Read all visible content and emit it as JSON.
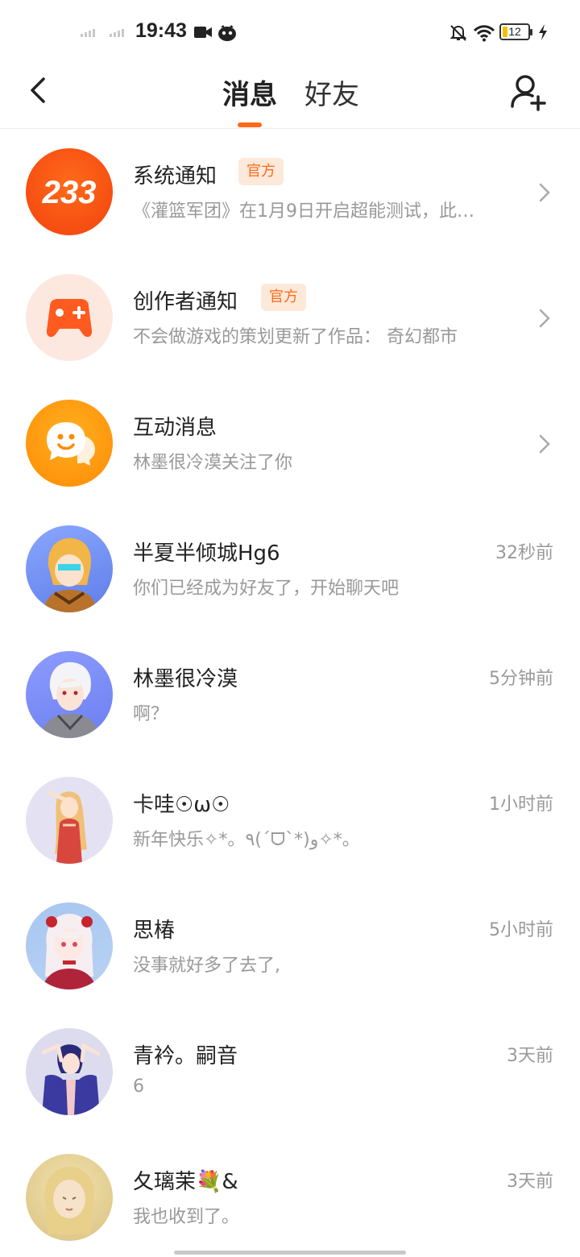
{
  "status_bar": {
    "time": "19:43",
    "battery": "12",
    "icons": [
      "video-camera-icon",
      "app-notification-icon",
      "mute-bell-icon",
      "wifi-icon",
      "battery-icon",
      "charging-bolt-icon"
    ]
  },
  "header": {
    "tabs": [
      {
        "label": "消息",
        "active": true
      },
      {
        "label": "好友",
        "active": false
      }
    ],
    "accent_color": "#ff6a1a"
  },
  "messages": [
    {
      "name": "系统通知",
      "badge": "官方",
      "preview": "《灌篮军团》在1月9日开启超能测试，此…",
      "time": "",
      "avatar": "logo-233-icon"
    },
    {
      "name": "创作者通知",
      "badge": "官方",
      "preview": "不会做游戏的策划更新了作品：  奇幻都市",
      "time": "",
      "avatar": "gamepad-icon"
    },
    {
      "name": "互动消息",
      "badge": "",
      "preview": "林墨很冷漠关注了你",
      "time": "",
      "avatar": "chat-bubble-icon"
    },
    {
      "name": "半夏半倾城Hg6",
      "badge": "",
      "preview": "你们已经成为好友了，开始聊天吧",
      "time": "32秒前",
      "avatar": "anime-avatar"
    },
    {
      "name": "林墨很冷漠",
      "badge": "",
      "preview": "啊？",
      "time": "5分钟前",
      "avatar": "anime-avatar"
    },
    {
      "name": "卡哇☉ω☉",
      "badge": "",
      "preview": "新年快乐✧*。٩(ˊᗜˋ*)و✧*。",
      "time": "1小时前",
      "avatar": "anime-avatar"
    },
    {
      "name": "思椿",
      "badge": "",
      "preview": "没事就好多了去了,",
      "time": "5小时前",
      "avatar": "anime-avatar"
    },
    {
      "name": "青衿。嗣音",
      "badge": "",
      "preview": "6",
      "time": "3天前",
      "avatar": "anime-avatar"
    },
    {
      "name": "夂璃茉💐&",
      "badge": "",
      "preview": "我也收到了。",
      "time": "3天前",
      "avatar": "anime-avatar"
    }
  ]
}
